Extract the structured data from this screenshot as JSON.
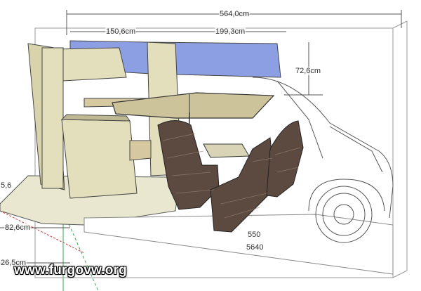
{
  "dimensions": {
    "total_length": "564,0cm",
    "upper_left": "150,6cm",
    "upper_right": "199,3cm",
    "height_right": "72,6cm",
    "left_side_height": "5,6",
    "left_depth": "82,6cm",
    "bottom_left": "26,5cm",
    "bottom_a": "550",
    "bottom_b": "5640"
  },
  "watermark": "www.furgovw.org",
  "colors": {
    "cabinet": "#e3dfbc",
    "cabinet_dark": "#bfb993",
    "wood": "#d6c9a0",
    "window": "#8d9fe3",
    "floor": "#e9e7cf",
    "seat": "#5c4a40",
    "grid_red": "#c23b3b",
    "grid_green": "#3fa45a"
  }
}
